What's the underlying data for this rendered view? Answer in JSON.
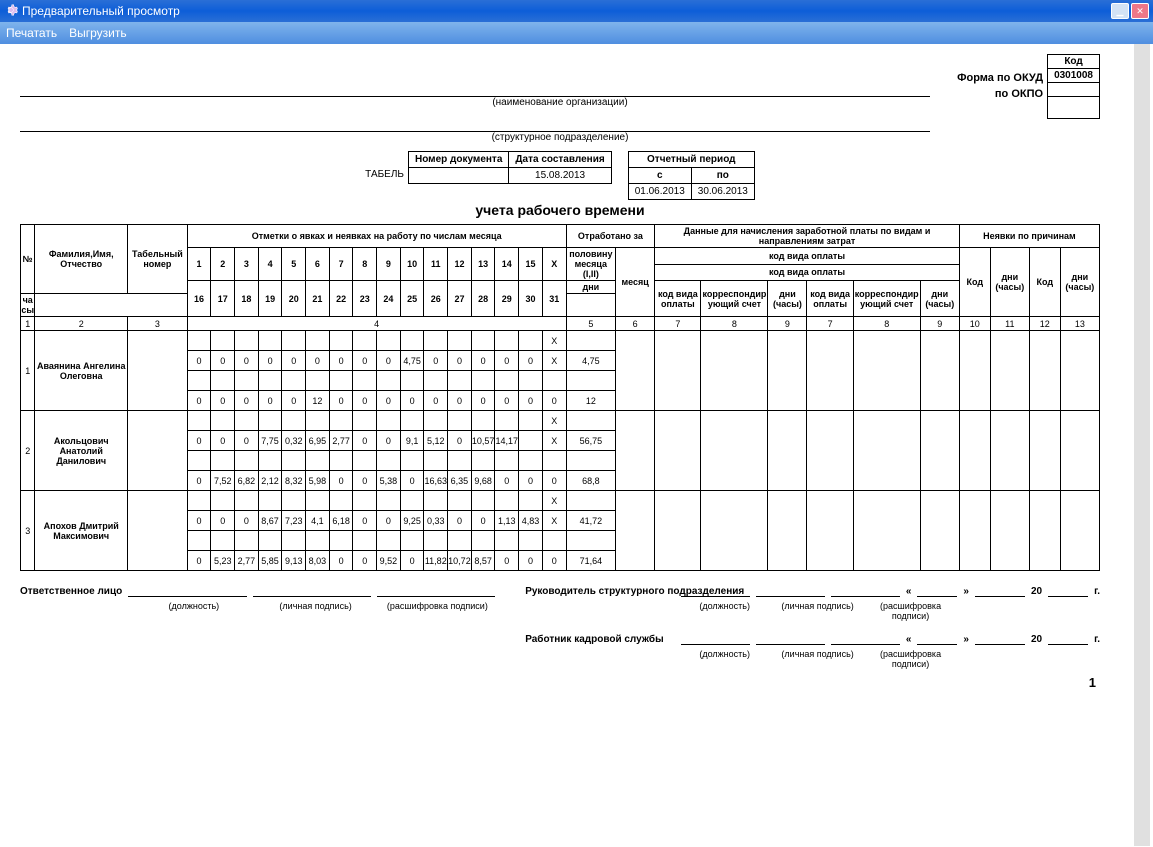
{
  "window": {
    "title": "Предварительный просмотр"
  },
  "menu": {
    "print": "Печатать",
    "export": "Выгрузить"
  },
  "form_labels": {
    "okud": "Форма по ОКУД",
    "okpo": "по ОКПО",
    "org_caption": "(наименование организации)",
    "struct_caption": "(структурное подразделение)",
    "code_header": "Код",
    "okud_code": "0301008",
    "okpo_code": ""
  },
  "doc": {
    "word": "ТАБЕЛЬ",
    "subtitle": "учета рабочего времени",
    "doc_num_h": "Номер документа",
    "doc_num": "",
    "date_h": "Дата составления",
    "date": "15.08.2013",
    "period_h": "Отчетный период",
    "from_h": "с",
    "to_h": "по",
    "from": "01.06.2013",
    "to": "30.06.2013"
  },
  "headers": {
    "num": "№",
    "fio": "Фамилия,Имя, Отчество",
    "tab_num": "Табельный номер",
    "marks": "Отметки о явках и неявках на работу по числам месяца",
    "worked": "Отработано за",
    "half": "половину месяца (I,II)",
    "month": "месяц",
    "days": "дни",
    "hours": "часы",
    "pay_data": "Данные для начисления заработной платы по видам и направлениям затрат",
    "pay_type": "код вида оплаты",
    "corr": "корреспондирующий счет",
    "days_hours": "дни (часы)",
    "absence": "Неявки по причинам",
    "code": "Код"
  },
  "day_top": [
    "1",
    "2",
    "3",
    "4",
    "5",
    "6",
    "7",
    "8",
    "9",
    "10",
    "11",
    "12",
    "13",
    "14",
    "15",
    "X"
  ],
  "day_bot": [
    "16",
    "17",
    "18",
    "19",
    "20",
    "21",
    "22",
    "23",
    "24",
    "25",
    "26",
    "27",
    "28",
    "29",
    "30",
    "31"
  ],
  "col_nums": [
    "1",
    "2",
    "3",
    "4",
    "5",
    "6",
    "7",
    "8",
    "9",
    "7",
    "8",
    "9",
    "10",
    "11",
    "12",
    "13"
  ],
  "employees": [
    {
      "n": "1",
      "fio": "Аваянина Ангелина Олеговна",
      "tab": "",
      "r1": [
        "",
        "",
        "",
        "",
        "",
        "",
        "",
        "",
        "",
        "",
        "",
        "",
        "",
        "",
        "",
        "X",
        ""
      ],
      "r2": [
        "0",
        "0",
        "0",
        "0",
        "0",
        "0",
        "0",
        "0",
        "0",
        "4,75",
        "0",
        "0",
        "0",
        "0",
        "0",
        "X",
        "4,75"
      ],
      "r3": [
        "",
        "",
        "",
        "",
        "",
        "",
        "",
        "",
        "",
        "",
        "",
        "",
        "",
        "",
        "",
        "",
        ""
      ],
      "r4": [
        "0",
        "0",
        "0",
        "0",
        "0",
        "12",
        "0",
        "0",
        "0",
        "0",
        "0",
        "0",
        "0",
        "0",
        "0",
        "0",
        "12"
      ]
    },
    {
      "n": "2",
      "fio": "Акольцович Анатолий Данилович",
      "tab": "",
      "r1": [
        "",
        "",
        "",
        "",
        "",
        "",
        "",
        "",
        "",
        "",
        "",
        "",
        "",
        "",
        "",
        "X",
        ""
      ],
      "r2": [
        "0",
        "0",
        "0",
        "7,75",
        "0,32",
        "6,95",
        "2,77",
        "0",
        "0",
        "9,1",
        "5,12",
        "0",
        "10,57",
        "14,17",
        "",
        "X",
        "56,75"
      ],
      "r3": [
        "",
        "",
        "",
        "",
        "",
        "",
        "",
        "",
        "",
        "",
        "",
        "",
        "",
        "",
        "",
        "",
        ""
      ],
      "r4": [
        "0",
        "7,52",
        "6,82",
        "2,12",
        "8,32",
        "5,98",
        "0",
        "0",
        "5,38",
        "0",
        "16,63",
        "6,35",
        "9,68",
        "0",
        "0",
        "0",
        "68,8"
      ]
    },
    {
      "n": "3",
      "fio": "Апохов Дмитрий Максимович",
      "tab": "",
      "r1": [
        "",
        "",
        "",
        "",
        "",
        "",
        "",
        "",
        "",
        "",
        "",
        "",
        "",
        "",
        "",
        "X",
        ""
      ],
      "r2": [
        "0",
        "0",
        "0",
        "8,67",
        "7,23",
        "4,1",
        "6,18",
        "0",
        "0",
        "9,25",
        "0,33",
        "0",
        "0",
        "1,13",
        "4,83",
        "X",
        "41,72"
      ],
      "r3": [
        "",
        "",
        "",
        "",
        "",
        "",
        "",
        "",
        "",
        "",
        "",
        "",
        "",
        "",
        "",
        "",
        ""
      ],
      "r4": [
        "0",
        "5,23",
        "2,77",
        "5,85",
        "9,13",
        "8,03",
        "0",
        "0",
        "9,52",
        "0",
        "11,82",
        "10,72",
        "8,57",
        "0",
        "0",
        "0",
        "71,64"
      ]
    }
  ],
  "sig": {
    "resp": "Ответственное лицо",
    "head": "Руководитель структурного подразделения",
    "hr": "Работник кадровой службы",
    "pos": "(должность)",
    "sign": "(личная подпись)",
    "decrypt": "(расшифровка подписи)",
    "quote1": "«",
    "quote2": "»",
    "year_prefix": "20",
    "year_suffix": "г."
  },
  "page_num": "1"
}
